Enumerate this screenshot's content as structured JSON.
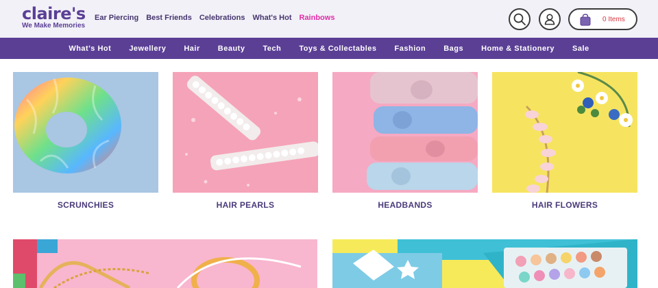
{
  "brand": {
    "name": "claire's",
    "tagline": "We Make Memories",
    "color": "#5b3f95"
  },
  "top_links": [
    {
      "label": "Ear Piercing",
      "color": "#46356e"
    },
    {
      "label": "Best Friends",
      "color": "#46356e"
    },
    {
      "label": "Celebrations",
      "color": "#46356e"
    },
    {
      "label": "What's Hot",
      "color": "#46356e"
    },
    {
      "label": "Rainbows",
      "color": "#e22ca8"
    }
  ],
  "header_icons": {
    "search": "search-icon",
    "account": "user-icon",
    "cart": "shopping-bag-icon"
  },
  "cart": {
    "count_text": "0 Items"
  },
  "nav": {
    "items": [
      "What's Hot",
      "Jewellery",
      "Hair",
      "Beauty",
      "Tech",
      "Toys & Collectables",
      "Fashion",
      "Bags",
      "Home & Stationery",
      "Sale"
    ]
  },
  "categories": [
    {
      "label": "SCRUNCHIES"
    },
    {
      "label": "HAIR PEARLS"
    },
    {
      "label": "HEADBANDS"
    },
    {
      "label": "HAIR FLOWERS"
    }
  ],
  "colors": {
    "header_bg": "#f2f1f8",
    "nav_bg": "#5b3f95",
    "sale_accent": "#e22ca8",
    "cart_count": "#d9363e"
  }
}
